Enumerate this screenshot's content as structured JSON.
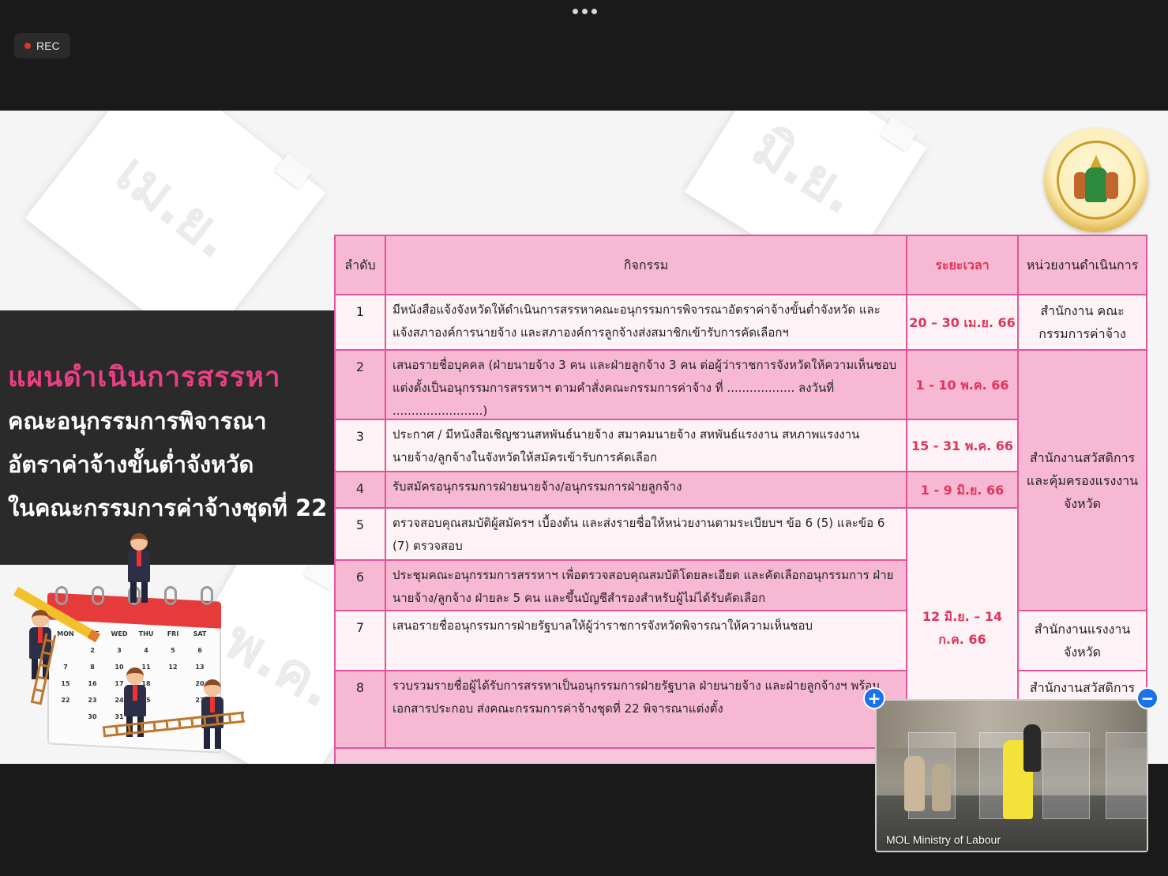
{
  "top_bar": {
    "rec_label": "REC"
  },
  "slide": {
    "paper_labels": [
      "เม.ย.",
      "มิ.ย.",
      "พ.ค."
    ],
    "title_pink": "แผนดำเนินการสรรหา",
    "title_lines": [
      "คณะอนุกรรมการพิจารณา",
      "อัตราค่าจ้างขั้นต่ำจังหวัด",
      "ในคณะกรรมการค่าจ้างชุดที่ 22"
    ],
    "calendar_days": [
      "MON",
      "TUE",
      "WED",
      "THU",
      "FRI",
      "SAT",
      "",
      "2",
      "3",
      "4",
      "5",
      "6",
      "7",
      "8",
      "10",
      "11",
      "12",
      "13",
      "15",
      "16",
      "17",
      "18",
      "",
      "20",
      "22",
      "23",
      "24",
      "25",
      "",
      "27",
      "",
      "30",
      "31",
      "",
      "",
      ""
    ],
    "table": {
      "headers": [
        "ลำดับ",
        "กิจกรรม",
        "ระยะเวลา",
        "หน่วยงานดำเนินการ"
      ],
      "rows": [
        {
          "no": "1",
          "activity": "มีหนังสือแจ้งจังหวัดให้ดำเนินการสรรหาคณะอนุกรรมการพิจารณาอัตราค่าจ้างขั้นต่ำจังหวัด และแจ้งสภาองค์การนายจ้าง และสภาองค์การลูกจ้างส่งสมาชิกเข้ารับการคัดเลือกฯ"
        },
        {
          "no": "2",
          "activity": "เสนอรายชื่อบุคคล (ฝ่ายนายจ้าง 3 คน และฝ่ายลูกจ้าง 3 คน ต่อผู้ว่าราชการจังหวัดให้ความเห็นชอบแต่งตั้งเป็นอนุกรรมการสรรหาฯ ตามคำสั่งคณะกรรมการค่าจ้าง ที่ .................. ลงวันที่ ........................)"
        },
        {
          "no": "3",
          "activity": "ประกาศ / มีหนังสือเชิญชวนสหพันธ์นายจ้าง สมาคมนายจ้าง สหพันธ์แรงงาน สหภาพแรงงาน นายจ้าง/ลูกจ้างในจังหวัดให้สมัครเข้ารับการคัดเลือก"
        },
        {
          "no": "4",
          "activity": "รับสมัครอนุกรรมการฝ่ายนายจ้าง/อนุกรรมการฝ่ายลูกจ้าง"
        },
        {
          "no": "5",
          "activity": "ตรวจสอบคุณสมบัติผู้สมัครฯ เบื้องต้น และส่งรายชื่อให้หน่วยงานตามระเบียบฯ ข้อ 6 (5) และข้อ 6 (7) ตรวจสอบ"
        },
        {
          "no": "6",
          "activity": "ประชุมคณะอนุกรรมการสรรหาฯ เพื่อตรวจสอบคุณสมบัติโดยละเอียด และคัดเลือกอนุกรรมการ ฝ่ายนายจ้าง/ลูกจ้าง ฝ่ายละ 5 คน และขึ้นบัญชีสำรองสำหรับผู้ไม่ได้รับคัดเลือก"
        },
        {
          "no": "7",
          "activity": "เสนอรายชื่ออนุกรรมการฝ่ายรัฐบาลให้ผู้ว่าราชการจังหวัดพิจารณาให้ความเห็นชอบ"
        },
        {
          "no": "8",
          "activity": "รวบรวมรายชื่อผู้ได้รับการสรรหาเป็นอนุกรรมการฝ่ายรัฐบาล ฝ่ายนายจ้าง และฝ่ายลูกจ้างฯ พร้อมเอกสารประกอบ ส่งคณะกรรมการค่าจ้างชุดที่ 22 พิจารณาแต่งตั้ง"
        }
      ],
      "periods": [
        "20 – 30 เม.ย. 66",
        "1 - 10 พ.ค. 66",
        "15 - 31 พ.ค. 66",
        "1 - 9 มิ.ย. 66",
        "12 มิ.ย. – 14 ก.ค. 66"
      ],
      "units": [
        "สำนักงาน คณะกรรมการค่าจ้าง",
        "สำนักงานสวัสดิการ และคุ้มครองแรงงาน จังหวัด",
        "สำนักงานแรงงาน จังหวัด",
        "สำนักงานสวัสดิการ"
      ]
    }
  },
  "video": {
    "label": "MOL Ministry of Labour",
    "plus_button": "+",
    "minus_button": "−"
  },
  "colors": {
    "accent_pink": "#ea3f86",
    "table_border": "#e0559b",
    "period_red": "#e0345a",
    "video_button": "#1a73e8"
  }
}
